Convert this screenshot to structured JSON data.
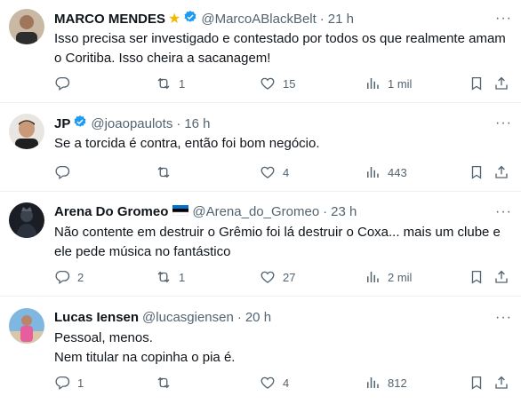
{
  "tweets": [
    {
      "name": "MARCO MENDES",
      "name_badge": "★",
      "verified": true,
      "handle": "@MarcoABlackBelt",
      "time": "21 h",
      "lines": [
        "Isso precisa ser investigado e contestado por todos os que realmente amam",
        "o Coritiba. Isso cheira a sacanagem!"
      ],
      "replies": "",
      "retweets": "1",
      "likes": "15",
      "views": "1 mil"
    },
    {
      "name": "JP",
      "verified": true,
      "handle": "@joaopaulots",
      "time": "16 h",
      "lines": [
        "Se a torcida é contra, então foi bom negócio."
      ],
      "replies": "",
      "retweets": "",
      "likes": "4",
      "views": "443"
    },
    {
      "name": "Arena Do Gromeo",
      "flag": "estonia-flag",
      "handle": "@Arena_do_Gromeo",
      "time": "23 h",
      "lines": [
        "Não contente em destruir o Grêmio foi lá destruir o Coxa... mais um clube e",
        "ele pede música no fantástico"
      ],
      "replies": "2",
      "retweets": "1",
      "likes": "27",
      "views": "2 mil"
    },
    {
      "name": "Lucas Iensen",
      "handle": "@lucasgiensen",
      "time": "20 h",
      "lines": [
        "Pessoal, menos.",
        "Nem titular na copinha o pia é."
      ],
      "replies": "1",
      "retweets": "",
      "likes": "4",
      "views": "812"
    }
  ],
  "separator": "·",
  "more_glyph": "···",
  "colors": {
    "verified": "#1d9bf0",
    "muted": "#536471",
    "text": "#0f1419",
    "star": "#f5b800"
  }
}
